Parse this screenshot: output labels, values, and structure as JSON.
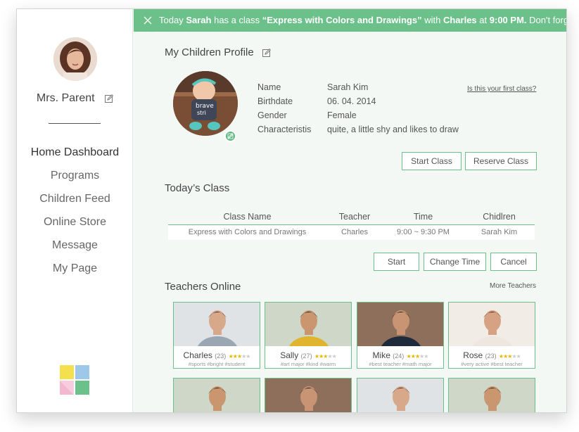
{
  "sidebar": {
    "parent_name": "Mrs. Parent",
    "nav": [
      "Home Dashboard",
      "Programs",
      "Children Feed",
      "Online Store",
      "Message",
      "My Page"
    ],
    "active": "Home Dashboard"
  },
  "banner": {
    "pre": "Today",
    "child": "Sarah",
    "mid1": "has  a class",
    "class_name": "“Express with Colors and Drawings”",
    "mid2": "with",
    "teacher": "Charles",
    "mid3": "at",
    "time": "9:00 PM.",
    "post": "Don't forget!"
  },
  "profile": {
    "title": "My Children Profile",
    "fields": [
      {
        "key": "Name",
        "value": "Sarah Kim"
      },
      {
        "key": "Birthdate",
        "value": "06. 04. 2014"
      },
      {
        "key": "Gender",
        "value": "Female"
      },
      {
        "key": "Characteristis",
        "value": "quite, a little shy and likes to draw"
      }
    ],
    "first_class_link": "Is this your first class?",
    "start_class": "Start Class",
    "reserve_class": "Reserve Class"
  },
  "todays_class": {
    "title": "Today’s Class",
    "headers": [
      "Class Name",
      "Teacher",
      "Time",
      "Chidlren"
    ],
    "row": [
      "Express with Colors and Drawings",
      "Charles",
      "9:00 ~ 9:30 PM",
      "Sarah Kim"
    ],
    "start": "Start",
    "change_time": "Change Time",
    "cancel": "Cancel"
  },
  "teachers": {
    "title": "Teachers Online",
    "more": "More Teachers",
    "cards": [
      {
        "name": "Charles",
        "age": "(23)",
        "stars": 3,
        "tags": "#sports #bright #student",
        "bg": "#dfe3e6",
        "skin": "#d7a98a",
        "hair": "#3a2a20",
        "shirt": "#9aa7b3"
      },
      {
        "name": "Sally",
        "age": "(27)",
        "stars": 3,
        "tags": "#art major #kind #warm",
        "bg": "#cfd8c8",
        "skin": "#c9966f",
        "hair": "#2b1d15",
        "shirt": "#e0b52d"
      },
      {
        "name": "Mike",
        "age": "(24)",
        "stars": 3,
        "tags": "#best teacher #math major",
        "bg": "#8e6f5c",
        "skin": "#c89474",
        "hair": "#20160f",
        "shirt": "#1f2a3a"
      },
      {
        "name": "Rose",
        "age": "(23)",
        "stars": 3,
        "tags": "#very active #best teacher",
        "bg": "#f1ece6",
        "skin": "#d7a283",
        "hair": "#4a2518",
        "shirt": "#eee7e0"
      },
      {
        "name": "",
        "age": "",
        "stars": 0,
        "tags": "",
        "bg": "#cfd8c8",
        "skin": "#c9966f",
        "hair": "#2b1d15",
        "shirt": "#e0b52d"
      },
      {
        "name": "",
        "age": "",
        "stars": 0,
        "tags": "",
        "bg": "#8e6f5c",
        "skin": "#c89474",
        "hair": "#20160f",
        "shirt": "#1f2a3a"
      },
      {
        "name": "",
        "age": "",
        "stars": 0,
        "tags": "",
        "bg": "#dfe3e6",
        "skin": "#d7a98a",
        "hair": "#3a2a20",
        "shirt": "#2f3b4d"
      },
      {
        "name": "",
        "age": "",
        "stars": 0,
        "tags": "",
        "bg": "#cfd8c8",
        "skin": "#c9966f",
        "hair": "#2b1d15",
        "shirt": "#e0b52d"
      }
    ]
  },
  "colors": {
    "accent": "#6cc08a",
    "panel": "#f3f8f5"
  }
}
